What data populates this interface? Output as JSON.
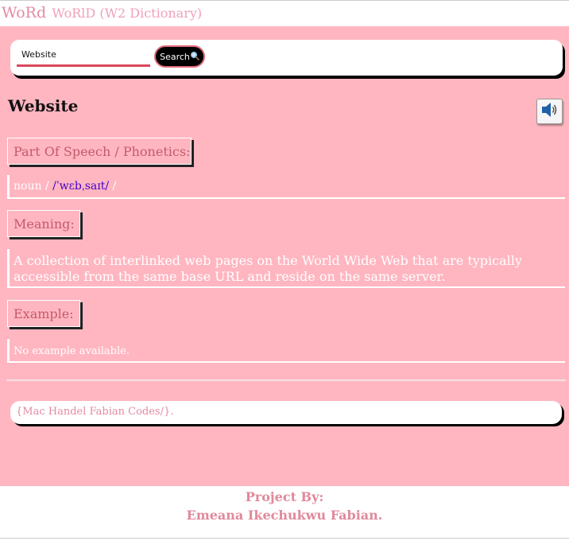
{
  "brand": {
    "main": "WoRd",
    "sub": "WoRlD (W2 Dictionary)"
  },
  "search": {
    "value": "Website",
    "button_label": "Search",
    "button_icon": "magnifier-icon"
  },
  "entry": {
    "word": "Website",
    "speaker_icon": "speaker-icon",
    "pos_heading": "Part Of Speech / Phonetics:",
    "pos": "noun /",
    "phonetic": "/ˈwɛbˌsaɪt/",
    "pos_trailing": "/",
    "meaning_heading": "Meaning:",
    "meaning": "A collection of interlinked web pages on the World Wide Web that are typically accessible from the same base URL and reside on the same server.",
    "example_heading": "Example:",
    "example": "No example available."
  },
  "credit": "{Mac Handel Fabian Codes/}.",
  "footer": {
    "line1": "Project By:",
    "line2": "Emeana Ikechukwu Fabian."
  },
  "colors": {
    "background": "#ffb6c1",
    "brand": "#e48aa3",
    "accent": "#d9475a",
    "phonetic": "#4400cc"
  }
}
